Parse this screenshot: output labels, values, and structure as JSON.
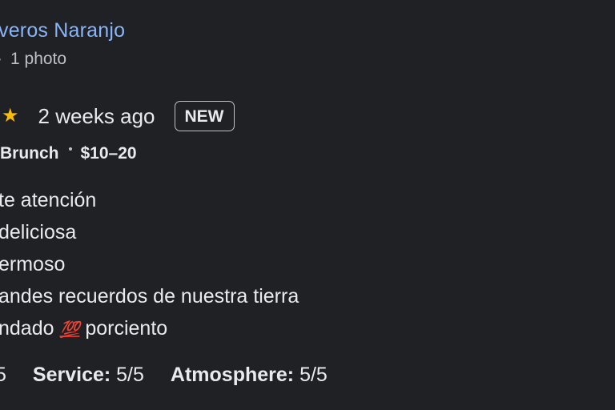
{
  "reviewer": {
    "name": "veros Naranjo",
    "meta": "1 photo"
  },
  "rating": {
    "stars_visible": 1.5,
    "time_ago": "2 weeks ago",
    "badge": "NEW"
  },
  "tags": {
    "meal": "Brunch",
    "price": "$10–20"
  },
  "review": {
    "lines": [
      "te atención",
      "deliciosa",
      "ermoso",
      "andes recuerdos de nuestra tierra"
    ],
    "last_line_start": "ndado",
    "emoji": "💯",
    "last_line_end": "porciento"
  },
  "scores": {
    "food_value": "5",
    "service_label": "Service:",
    "service_value": "5/5",
    "atmosphere_label": "Atmosphere:",
    "atmosphere_value": "5/5"
  },
  "colors": {
    "background": "#202124",
    "link": "#8ab4f8",
    "star": "#fbbc04",
    "text": "#e8eaed"
  }
}
